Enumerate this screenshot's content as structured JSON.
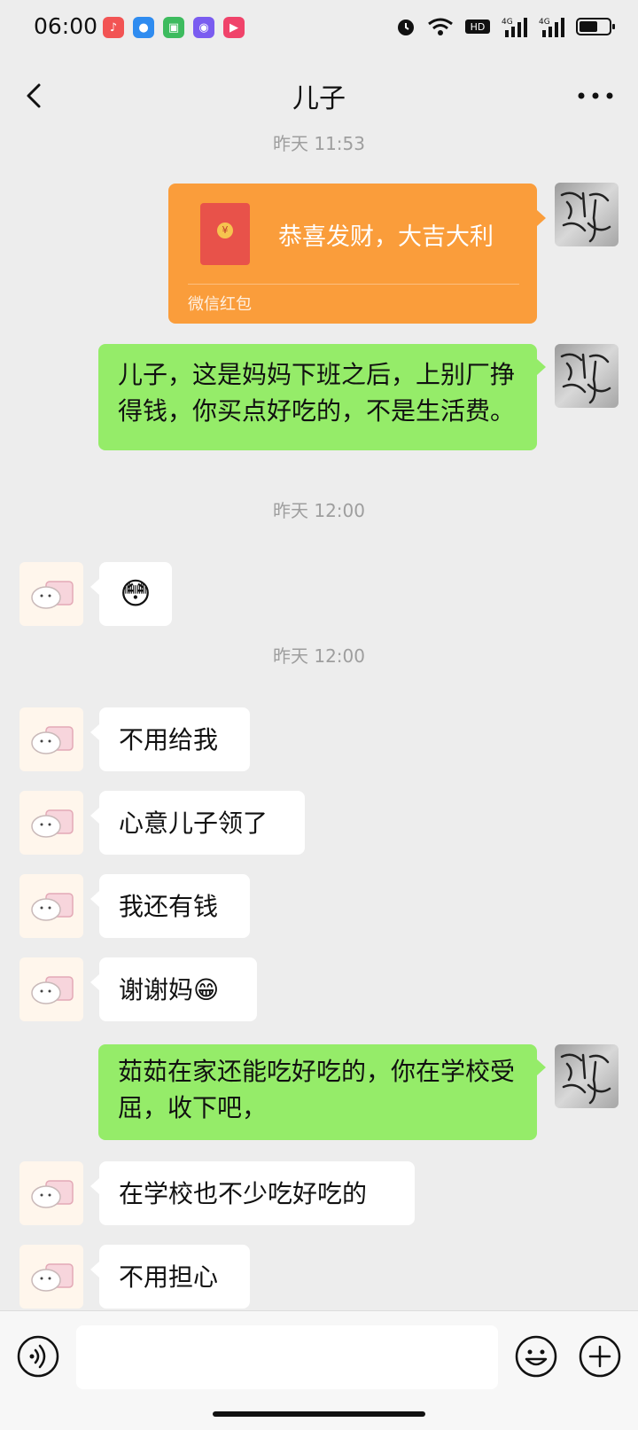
{
  "status_bar": {
    "time": "06:00",
    "apps": [
      {
        "name": "music-app-icon",
        "color": "#f25454",
        "glyph": "♪"
      },
      {
        "name": "browser-app-icon",
        "color": "#2f8cf0",
        "glyph": "●"
      },
      {
        "name": "android-app-icon",
        "color": "#3dbb5e",
        "glyph": "▣"
      },
      {
        "name": "camera-app-icon",
        "color": "#7a5cf0",
        "glyph": "◉"
      },
      {
        "name": "video-app-icon",
        "color": "#f0436a",
        "glyph": "▶"
      }
    ],
    "network": [
      "HD2",
      "4G",
      "4G"
    ]
  },
  "nav": {
    "title": "儿子"
  },
  "messages": {
    "time1": "昨天 11:53",
    "red_packet": {
      "text": "恭喜发财，大吉大利",
      "label": "微信红包",
      "color": "#fa9d3b"
    },
    "msg1": "儿子，这是妈妈下班之后，上别厂挣得钱，你买点好吃的，不是生活费。",
    "time2": "昨天 12:00",
    "msg2_emoji": "😳",
    "time3": "昨天 12:00",
    "msg3": "不用给我",
    "msg4": "心意儿子领了",
    "msg5": "我还有钱",
    "msg6": "谢谢妈😁",
    "msg7": "茹茹在家还能吃好吃的，你在学校受屈，收下吧，",
    "msg8": "在学校也不少吃好吃的",
    "msg9": "不用担心"
  },
  "input": {
    "placeholder": ""
  },
  "colors": {
    "background": "#ededed",
    "self_bubble": "#95ec69",
    "other_bubble": "#ffffff"
  }
}
